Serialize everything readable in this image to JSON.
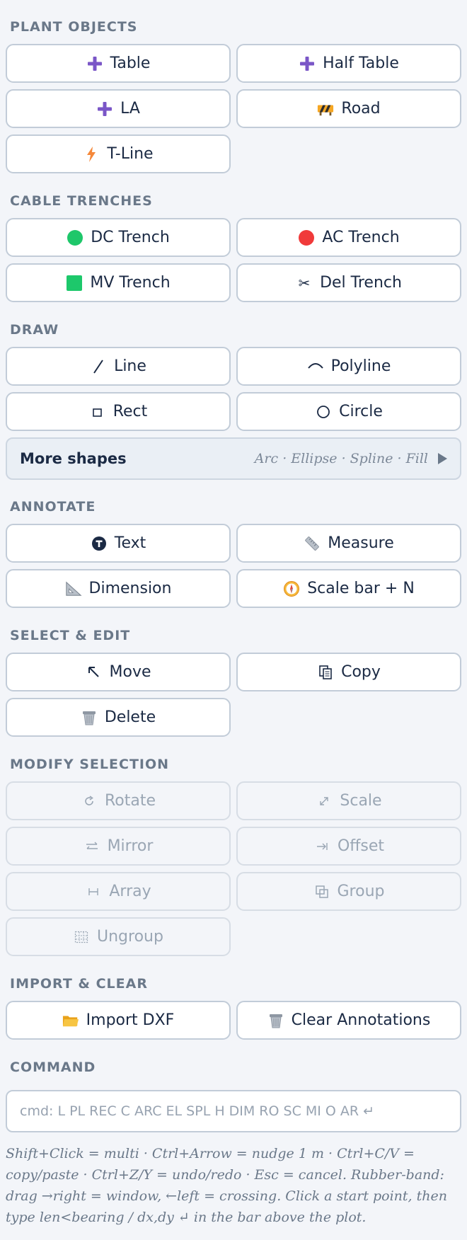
{
  "sections": {
    "plant_objects": "PLANT OBJECTS",
    "cable_trenches": "CABLE TRENCHES",
    "draw": "DRAW",
    "annotate": "ANNOTATE",
    "select_edit": "SELECT & EDIT",
    "modify_selection": "MODIFY SELECTION",
    "import_clear": "IMPORT & CLEAR",
    "command": "COMMAND"
  },
  "plant_objects": {
    "table": "Table",
    "half_table": "Half Table",
    "la": "LA",
    "road": "Road",
    "t_line": "T-Line"
  },
  "cable_trenches": {
    "dc": "DC Trench",
    "ac": "AC Trench",
    "mv": "MV Trench",
    "del": "Del Trench"
  },
  "draw": {
    "line": "Line",
    "polyline": "Polyline",
    "rect": "Rect",
    "circle": "Circle",
    "more_label": "More shapes",
    "more_hint": "Arc · Ellipse · Spline · Fill"
  },
  "annotate": {
    "text": "Text",
    "measure": "Measure",
    "dimension": "Dimension",
    "scale_bar": "Scale bar + N"
  },
  "select_edit": {
    "move": "Move",
    "copy": "Copy",
    "delete": "Delete"
  },
  "modify_selection": {
    "rotate": "Rotate",
    "scale": "Scale",
    "mirror": "Mirror",
    "offset": "Offset",
    "array": "Array",
    "group": "Group",
    "ungroup": "Ungroup"
  },
  "import_clear": {
    "import_dxf": "Import DXF",
    "clear_annotations": "Clear Annotations"
  },
  "command": {
    "placeholder": "cmd: L PL REC C ARC EL SPL H DIM RO SC MI O AR ↵",
    "help": "Shift+Click = multi · Ctrl+Arrow = nudge 1 m · Ctrl+C/V = copy/paste · Ctrl+Z/Y = undo/redo · Esc = cancel. Rubber-band: drag →right = window, ←left = crossing. Click a start point, then type len<bearing / dx,dy ↵ in the bar above the plot."
  },
  "colors": {
    "accent_purple": "#7a56c7",
    "dc_green": "#1ec76a",
    "ac_red": "#f03a3a",
    "mv_green": "#1dc86b",
    "section_gray": "#6a7889",
    "disabled_text": "#9aa6b4"
  }
}
